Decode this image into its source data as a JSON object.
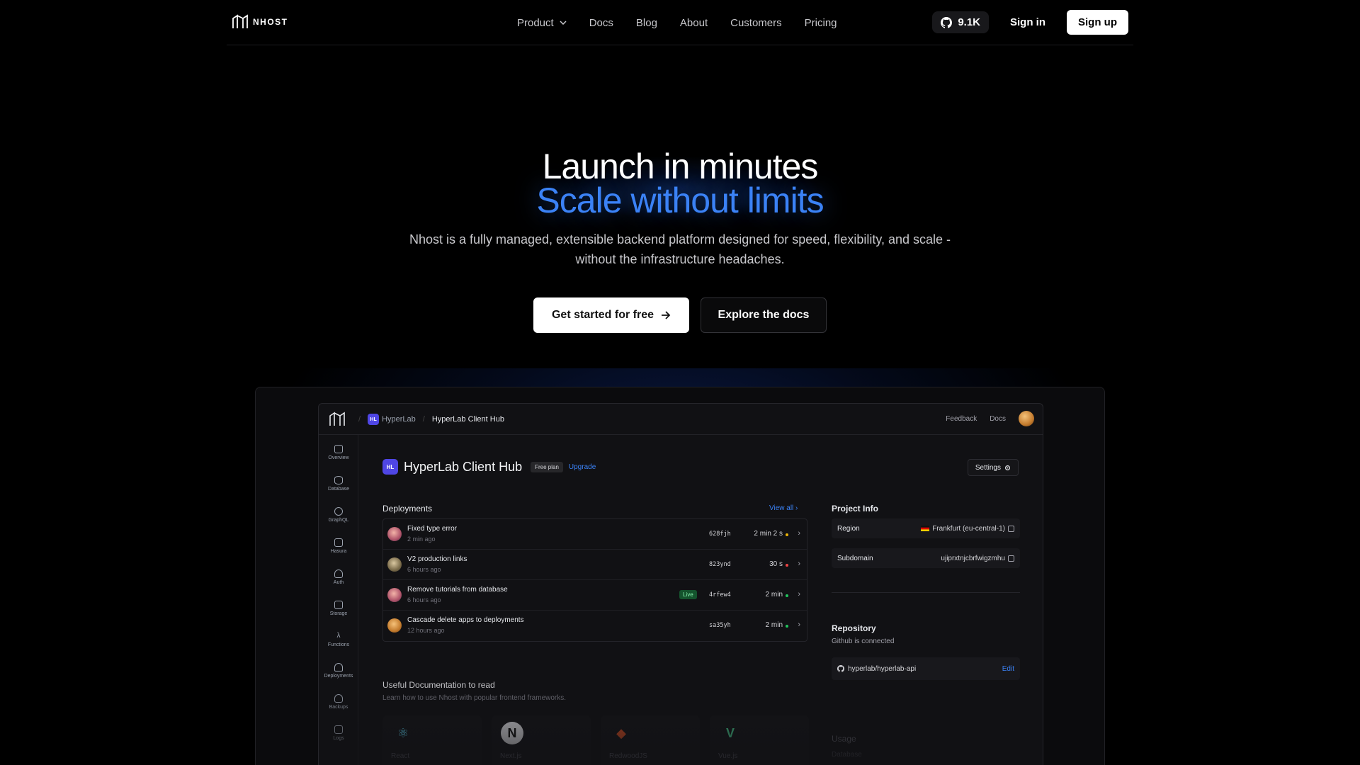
{
  "nav": {
    "logo_text": "NHOST",
    "links": [
      {
        "label": "Product",
        "has_dropdown": true
      },
      {
        "label": "Docs"
      },
      {
        "label": "Blog"
      },
      {
        "label": "About"
      },
      {
        "label": "Customers"
      },
      {
        "label": "Pricing"
      }
    ],
    "github_stars": "9.1K",
    "signin_label": "Sign in",
    "signup_label": "Sign up"
  },
  "hero": {
    "line1": "Launch in minutes",
    "line2": "Scale without limits",
    "subtitle": "Nhost is a fully managed, extensible backend platform designed for speed, flexibility, and scale - without the infrastructure headaches.",
    "cta_primary": "Get started for free",
    "cta_secondary": "Explore the docs",
    "accent_color": "#3b82f6"
  },
  "app": {
    "breadcrumbs": [
      "HyperLab",
      "HyperLab Client Hub"
    ],
    "top_links": [
      "Feedback",
      "Docs"
    ],
    "sidebar": [
      "Overview",
      "Database",
      "GraphQL",
      "Hasura",
      "Auth",
      "Storage",
      "Functions",
      "Deployments",
      "Backups",
      "Logs"
    ],
    "project_title": "HyperLab Client Hub",
    "plan": "Free plan",
    "upgrade": "Upgrade",
    "settings": "Settings",
    "deployments_title": "Deployments",
    "view_all": "View all",
    "deployments": [
      {
        "title": "Fixed type error",
        "time": "2 min ago",
        "sha": "628fjh",
        "duration": "2 min 2 s",
        "status_color": "#eab308",
        "live": ""
      },
      {
        "title": "V2 production links",
        "time": "6 hours ago",
        "sha": "823ynd",
        "duration": "30 s",
        "status_color": "#ef4444",
        "live": ""
      },
      {
        "title": "Remove tutorials from database",
        "time": "6 hours ago",
        "sha": "4rfew4",
        "duration": "2 min",
        "status_color": "#22c55e",
        "live": "Live"
      },
      {
        "title": "Cascade delete apps to deployments",
        "time": "12 hours ago",
        "sha": "sa35yh",
        "duration": "2 min",
        "status_color": "#22c55e",
        "live": ""
      }
    ],
    "project_info_title": "Project Info",
    "region_label": "Region",
    "region_value": "Frankfurt (eu-central-1)",
    "subdomain_label": "Subdomain",
    "subdomain_value": "ujiprxtnjcbrfwigzmhu",
    "repository_title": "Repository",
    "repository_status": "Github is connected",
    "repository_name": "hyperlab/hyperlab-api",
    "repository_edit": "Edit",
    "docs_title": "Useful Documentation to read",
    "docs_subtitle": "Learn how to use Nhost with popular frontend frameworks.",
    "frameworks": [
      "React",
      "Next.js",
      "RedwoodJS",
      "Vue.js"
    ],
    "usage_title": "Usage",
    "usage_database": "Database"
  }
}
